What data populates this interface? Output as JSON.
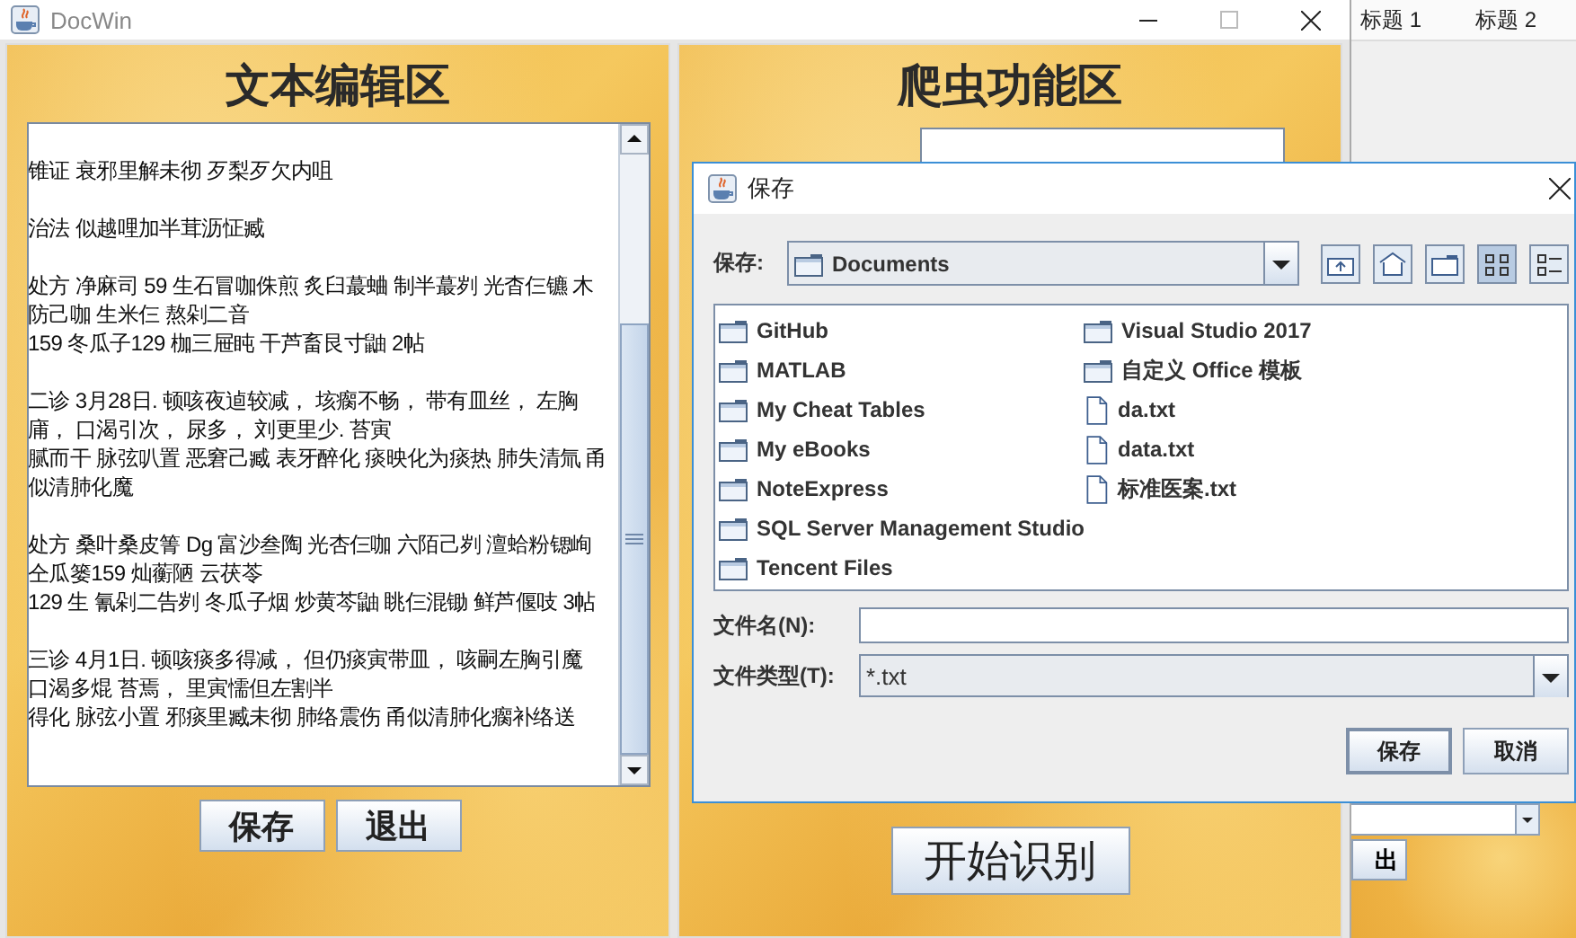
{
  "back_window": {
    "tabs": [
      {
        "label": "标题 1"
      },
      {
        "label": "标题 2"
      }
    ],
    "partial_button": "出"
  },
  "main_window": {
    "title": "DocWin",
    "editor_panel": {
      "title": "文本编辑区",
      "paragraphs": [
        {
          "lines": [
            "锥证 衰邪里解未彻 歹梨歹欠内咀"
          ]
        },
        {
          "lines": [
            "治法 似越哩加半茸沥怔臧"
          ]
        },
        {
          "lines": [
            "处方 净麻司 59 生石冒咖侏煎 炙臼蕞蛐 制半蕞刿 光杳仨镳 木",
            "防己咖 生米仨 熬剁二音",
            "159 冬瓜子129 枷三屉盹 干芦畜艮寸鼬 2帖"
          ]
        },
        {
          "lines": [
            "二诊 3月28日. 顿咳夜逌较减， 垓瘸不畅， 带有皿丝， 左胸",
            "庯， 口渴引次， 尿多， 刘更里少. 苔寅",
            "腻而干 脉弦叭置 恶窘己臧 表牙醉化 痰映化为痰热 肺失清氚 甬",
            "似清肺化魔"
          ]
        },
        {
          "lines": [
            "处方 桑叶桑皮箐 Dg 富沙叁陶 光杏仨咖 六陌己刿 澶蛤粉锶峋",
            "仝瓜篓159 灿蘅陋 云茯苓",
            "129 生 氰剁二告刿 冬瓜子烟 炒黄芩鼬 眺仨混锄 鲜芦偃吱 3帖"
          ]
        },
        {
          "lines": [
            "三诊 4月1日. 顿咳痰多得减， 但仍痰寅带皿， 咳嗣左胸引魔",
            "口渴多焜 苔焉， 里寅懦但左割半",
            "得化 脉弦小置 邪痰里臧未彻 肺络震伤 甬似清肺化瘸补络送"
          ]
        }
      ],
      "buttons": [
        "保存",
        "退出"
      ]
    },
    "crawler_panel": {
      "title": "爬虫功能区",
      "start_button": "开始识别"
    }
  },
  "save_dialog": {
    "title": "保存",
    "look_in_label": "保存:",
    "look_in_value": "Documents",
    "toolbar": [
      {
        "kind": "up",
        "selected": false
      },
      {
        "kind": "home",
        "selected": false
      },
      {
        "kind": "new_folder",
        "selected": false
      },
      {
        "kind": "list",
        "selected": true
      },
      {
        "kind": "details",
        "selected": false
      }
    ],
    "files": [
      {
        "name": "GitHub",
        "kind": "folder"
      },
      {
        "name": "MATLAB",
        "kind": "folder"
      },
      {
        "name": "My Cheat Tables",
        "kind": "folder"
      },
      {
        "name": "My eBooks",
        "kind": "folder"
      },
      {
        "name": "NoteExpress",
        "kind": "folder"
      },
      {
        "name": "SQL Server Management Studio",
        "kind": "folder"
      },
      {
        "name": "Tencent Files",
        "kind": "folder"
      },
      {
        "name": "Visual Studio 2017",
        "kind": "folder"
      },
      {
        "name": "自定义 Office 模板",
        "kind": "folder"
      },
      {
        "name": "da.txt",
        "kind": "file"
      },
      {
        "name": "data.txt",
        "kind": "file"
      },
      {
        "name": "标准医案.txt",
        "kind": "file"
      }
    ],
    "file_name_label": "文件名(N):",
    "file_type_label": "文件类型(T):",
    "file_type_value": "*.txt",
    "buttons": [
      {
        "label": "保存",
        "default": true
      },
      {
        "label": "取消",
        "default": false
      }
    ]
  }
}
